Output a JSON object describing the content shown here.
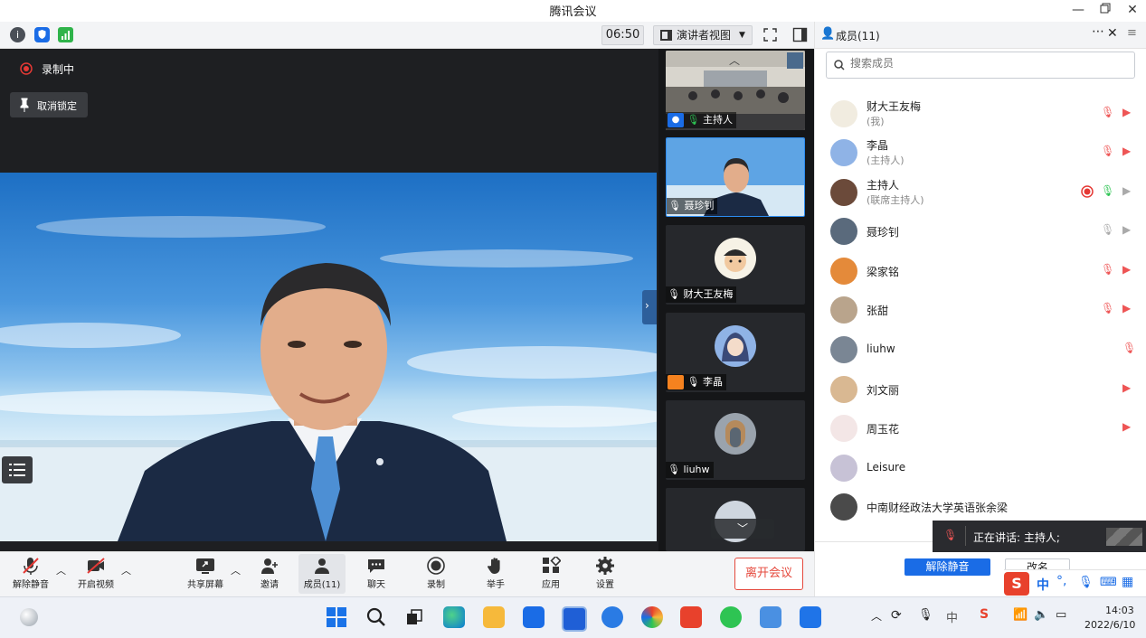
{
  "window": {
    "title": "腾讯会议"
  },
  "toolbar": {
    "time": "06:50",
    "view_label": "演讲者视图"
  },
  "recording": {
    "label": "录制中"
  },
  "pin": {
    "label": "取消锁定"
  },
  "members_panel": {
    "title": "成员(11)",
    "search_placeholder": "搜索成员",
    "members": [
      {
        "name": "财大王友梅",
        "role": "(我)"
      },
      {
        "name": "李晶",
        "role": "(主持人)"
      },
      {
        "name": "主持人",
        "role": "(联席主持人)"
      },
      {
        "name": "聂珍钊"
      },
      {
        "name": "梁家铭"
      },
      {
        "name": "张甜"
      },
      {
        "name": "liuhw"
      },
      {
        "name": "刘文丽"
      },
      {
        "name": "周玉花"
      },
      {
        "name": "Leisure"
      },
      {
        "name": "中南财经政法大学英语张余梁"
      }
    ],
    "unmute_all_label": "解除静音",
    "rename_label": "改名"
  },
  "speaking": {
    "label": "正在讲话: 主持人;"
  },
  "thumbnails": [
    {
      "label": "主持人"
    },
    {
      "label": "聂珍钊"
    },
    {
      "label": "财大王友梅"
    },
    {
      "label": "李晶"
    },
    {
      "label": "liuhw"
    }
  ],
  "bottom_bar": {
    "unmute": "解除静音",
    "start_video": "开启视频",
    "share_screen": "共享屏幕",
    "invite": "邀请",
    "members": "成员(11)",
    "chat": "聊天",
    "record": "录制",
    "raise_hand": "举手",
    "apps": "应用",
    "settings": "设置",
    "leave": "离开会议"
  },
  "ime": {
    "mode": "中"
  },
  "taskbar": {
    "time": "14:03",
    "date": "2022/6/10",
    "tray_ime": "中"
  },
  "colors": {
    "accent": "#1a6ce6",
    "leave_red": "#e5493d",
    "record_red": "#e53935",
    "mic_green": "#2ec453"
  }
}
